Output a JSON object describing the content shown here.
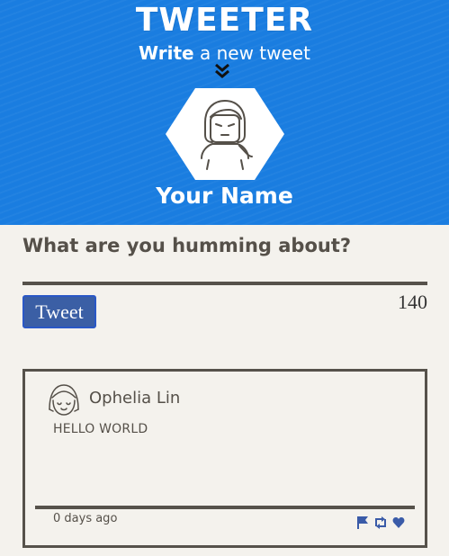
{
  "header": {
    "brand": "TWEETER",
    "subtitle_strong": "Write",
    "subtitle_rest": "a new tweet",
    "user_name": "Your Name"
  },
  "compose": {
    "prompt": "What are you humming about?",
    "tweet_button_label": "Tweet",
    "char_count": "140"
  },
  "feed": {
    "tweets": [
      {
        "author": "Ophelia Lin",
        "message": "HELLO WORLD",
        "timestamp": "0 days ago",
        "actions": [
          "flag-icon",
          "retweet-icon",
          "heart-icon"
        ]
      }
    ]
  },
  "colors": {
    "header_bg": "#1a7de0",
    "page_bg": "#f4f2ed",
    "text": "#555049",
    "button": "#3b5fa5",
    "action_icon": "#3a5ba8"
  }
}
